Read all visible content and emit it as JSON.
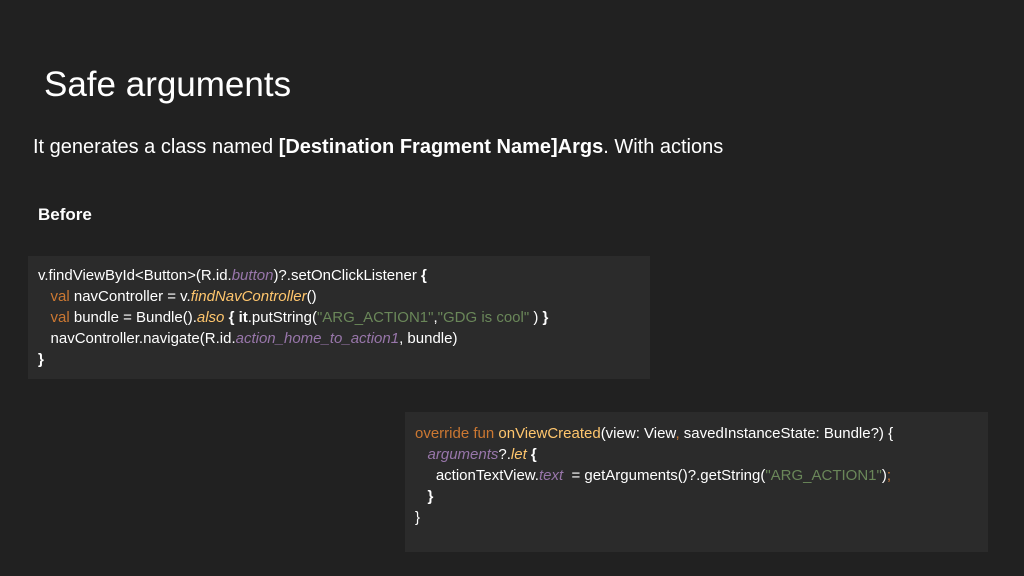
{
  "slide": {
    "title": "Safe arguments",
    "subtitle": {
      "prefix": "It generates a class named ",
      "bold": "[Destination Fragment Name]Args",
      "suffix": ". With actions"
    },
    "before_label": "Before"
  },
  "code_before": {
    "l1_a": "v.findViewById<Button>(R.id.",
    "l1_b": "button",
    "l1_c": ")?.setOnClickListener ",
    "l1_d": "{",
    "l2_indent": "   ",
    "l2_kw": "val",
    "l2_a": " navController = v.",
    "l2_fn": "findNavController",
    "l2_b": "()",
    "l3_indent": "   ",
    "l3_kw": "val",
    "l3_a": " bundle = Bundle().",
    "l3_fn": "also",
    "l3_b": " ",
    "l3_brace1": "{",
    "l3_c": " ",
    "l3_it": "it",
    "l3_d": ".putString(",
    "l3_s1": "\"ARG_ACTION1\"",
    "l3_e": ",",
    "l3_s2": "\"GDG is cool\"",
    "l3_f": " ) ",
    "l3_brace2": "}",
    "l4_indent": "   ",
    "l4_a": "navController.navigate(R.id.",
    "l4_b": "action_home_to_action1",
    "l4_c": ", bundle)",
    "l5": "}"
  },
  "code_after": {
    "l1_kw": "override fun",
    "l1_a": " ",
    "l1_fn": "onViewCreated",
    "l1_b": "(view: View",
    "l1_comma": ",",
    "l1_c": " savedInstanceState: Bundle?) {",
    "l2_indent": "   ",
    "l2_arg": "arguments",
    "l2_a": "?.",
    "l2_let": "let",
    "l2_b": " ",
    "l2_brace": "{",
    "l3_indent": "     ",
    "l3_a": "actionTextView.",
    "l3_text": "text",
    "l3_b": "  = getArguments()?.getString(",
    "l3_str": "\"ARG_ACTION1\"",
    "l3_c": ")",
    "l3_semi": ";",
    "l4_indent": "   ",
    "l4_brace": "}",
    "l5": "}"
  }
}
